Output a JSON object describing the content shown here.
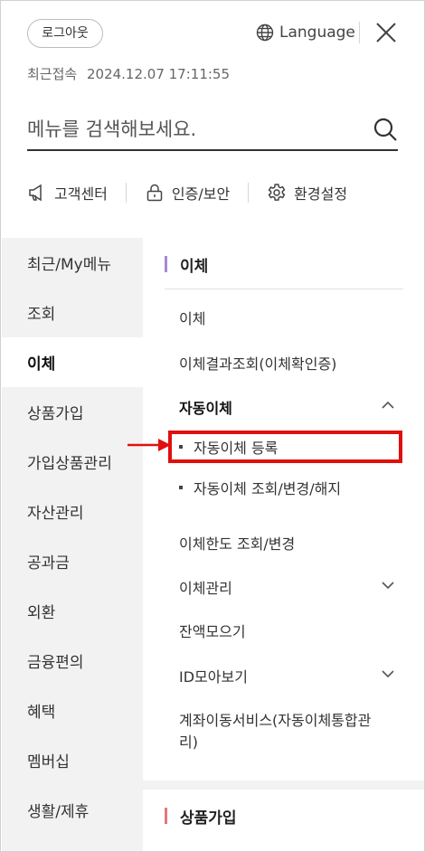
{
  "header": {
    "logout_label": "로그아웃",
    "language_label": "Language",
    "last_login_label": "최근접속",
    "last_login_value": "2024.12.07 17:11:55"
  },
  "search": {
    "placeholder": "메뉴를 검색해보세요."
  },
  "quick_menu": [
    {
      "label": "고객센터",
      "icon": "megaphone-icon"
    },
    {
      "label": "인증/보안",
      "icon": "lock-icon"
    },
    {
      "label": "환경설정",
      "icon": "gear-icon"
    }
  ],
  "left_menu": [
    {
      "label": "최근/My메뉴"
    },
    {
      "label": "조회"
    },
    {
      "label": "이체"
    },
    {
      "label": "상품가입"
    },
    {
      "label": "가입상품관리"
    },
    {
      "label": "자산관리"
    },
    {
      "label": "공과금"
    },
    {
      "label": "외환"
    },
    {
      "label": "금융편의"
    },
    {
      "label": "혜택"
    },
    {
      "label": "멤버십"
    },
    {
      "label": "생활/제휴"
    }
  ],
  "active_left": "이체",
  "section": {
    "title": "이체",
    "items": [
      {
        "label": "이체"
      },
      {
        "label": "이체결과조회(이체확인증)"
      },
      {
        "label": "자동이체"
      },
      {
        "label": "자동이체 등록"
      },
      {
        "label": "자동이체 조회/변경/해지"
      },
      {
        "label": "이체한도 조회/변경"
      },
      {
        "label": "이체관리"
      },
      {
        "label": "잔액모으기"
      },
      {
        "label": "ID모아보기"
      },
      {
        "label": "계좌이동서비스(자동이체통합관"
      },
      {
        "label": "리)"
      }
    ]
  },
  "section2": {
    "title": "상품가입"
  },
  "colors": {
    "accent_bar": "#a58bd6",
    "accent_bar2": "#e5777f",
    "highlight": "#e01010"
  }
}
